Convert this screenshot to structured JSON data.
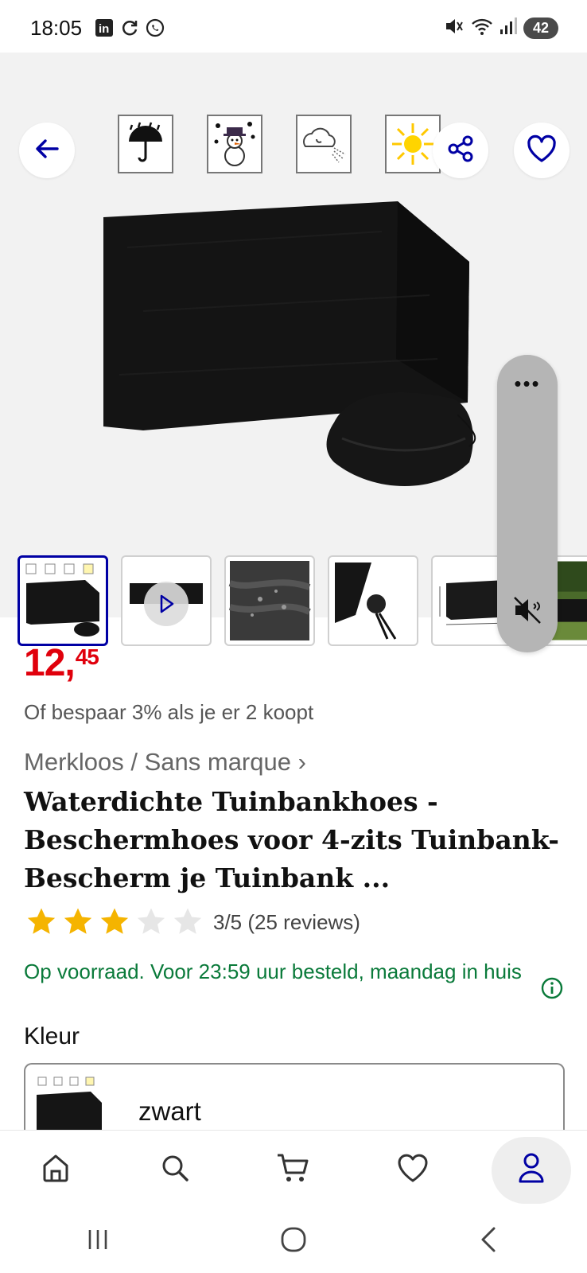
{
  "status_bar": {
    "time": "18:05",
    "battery": "42",
    "signal_label": "5"
  },
  "gallery": {
    "back_icon": "arrow-left-icon",
    "share_icon": "share-icon",
    "favorite_icon": "heart-icon",
    "weather_icons": [
      "umbrella-rain-icon",
      "snowman-icon",
      "wind-icon",
      "sun-icon"
    ],
    "thumbnails": [
      {
        "name": "thumb-bench-cover",
        "active": true
      },
      {
        "name": "thumb-video",
        "active": false
      },
      {
        "name": "thumb-fabric-detail",
        "active": false
      },
      {
        "name": "thumb-drawstring",
        "active": false
      },
      {
        "name": "thumb-dimensions",
        "active": false
      },
      {
        "name": "thumb-outdoor",
        "active": false
      }
    ]
  },
  "media_pill": {
    "menu_label": "•••",
    "mute_icon": "volume-mute-icon"
  },
  "product": {
    "price_whole": "12,",
    "price_fraction": "45",
    "offer": "Of bespaar 3% als je er 2 koopt",
    "brand": "Merkloos / Sans marque ›",
    "title": "Waterdichte Tuinbankhoes -Beschermhoes voor 4-zits Tuinbank- Bescherm je Tuinbank ...",
    "rating_value": 3,
    "rating_max": 5,
    "rating_text": "3/5 (25 reviews)",
    "stock": "Op voorraad. Voor 23:59 uur besteld, maandag in huis",
    "color_label": "Kleur",
    "color_value": "zwart"
  },
  "colors": {
    "price_red": "#e0000c",
    "stock_green": "#0a7a3a",
    "brand_blue": "#0000a4",
    "star_gold": "#f5b400"
  },
  "bottom_nav": {
    "items": [
      "home-icon",
      "search-icon",
      "cart-icon",
      "wishlist-icon",
      "account-icon"
    ]
  },
  "system_nav": {
    "items": [
      "recents-icon",
      "home-circle-icon",
      "back-chevron-icon"
    ]
  }
}
